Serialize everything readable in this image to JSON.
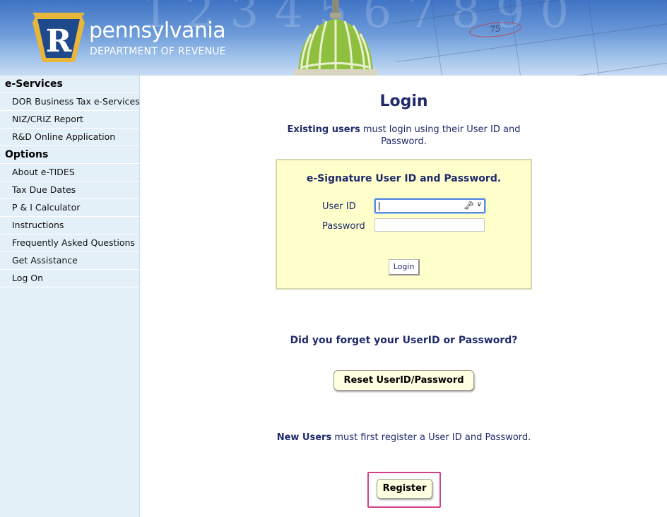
{
  "header": {
    "logo_letter": "R",
    "logo_word": "pennsylvania",
    "logo_subtitle": "DEPARTMENT OF REVENUE",
    "bg_numbers": "1234567890",
    "circled_number": "75"
  },
  "sidebar": {
    "sections": [
      {
        "heading": "e-Services",
        "items": [
          "DOR Business Tax e-Services",
          "NIZ/CRIZ Report",
          "R&D Online Application"
        ]
      },
      {
        "heading": "Options",
        "items": [
          "About e-TIDES",
          "Tax Due Dates",
          "P & I Calculator",
          "Instructions",
          "Frequently Asked Questions",
          "Get Assistance",
          "Log On"
        ]
      }
    ]
  },
  "main": {
    "title": "Login",
    "existing_bold": "Existing users",
    "existing_rest": " must login using their User ID and Password.",
    "box": {
      "title": "e-Signature User ID and Password.",
      "userid_label": "User ID",
      "userid_value": "",
      "password_label": "Password",
      "password_value": "",
      "login_button": "Login"
    },
    "forgot_text": "Did you forget your UserID or Password?",
    "reset_button": "Reset UserID/Password",
    "new_bold": "New Users",
    "new_rest": " must first register a User ID and Password.",
    "register_button": "Register"
  },
  "colors": {
    "text_navy": "#1f2a6b",
    "sidebar_bg": "#e3f0f8",
    "login_box_bg": "#ffffcc",
    "highlight": "#d63f86",
    "keystone_gold": "#e8b73a",
    "keystone_blue": "#1e4a8c"
  }
}
